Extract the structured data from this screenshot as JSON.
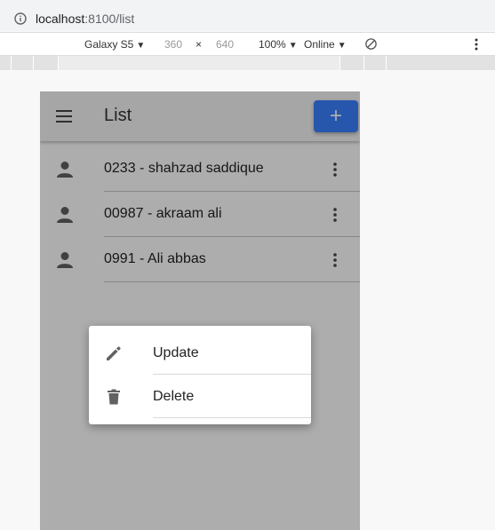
{
  "browser": {
    "url_host": "localhost",
    "url_rest": ":8100/list"
  },
  "device_toolbar": {
    "device": "Galaxy S5",
    "width": "360",
    "times": "×",
    "height": "640",
    "zoom": "100%",
    "network": "Online"
  },
  "app": {
    "title": "List",
    "add_label": "+",
    "items": [
      {
        "label": "0233 - shahzad saddique"
      },
      {
        "label": "00987 - akraam ali"
      },
      {
        "label": "0991 - Ali abbas"
      }
    ]
  },
  "popover": {
    "items": [
      {
        "label": "Update",
        "icon": "pencil-icon"
      },
      {
        "label": "Delete",
        "icon": "trash-icon"
      }
    ]
  },
  "colors": {
    "accent": "#3880ff",
    "icon": "#616161"
  }
}
